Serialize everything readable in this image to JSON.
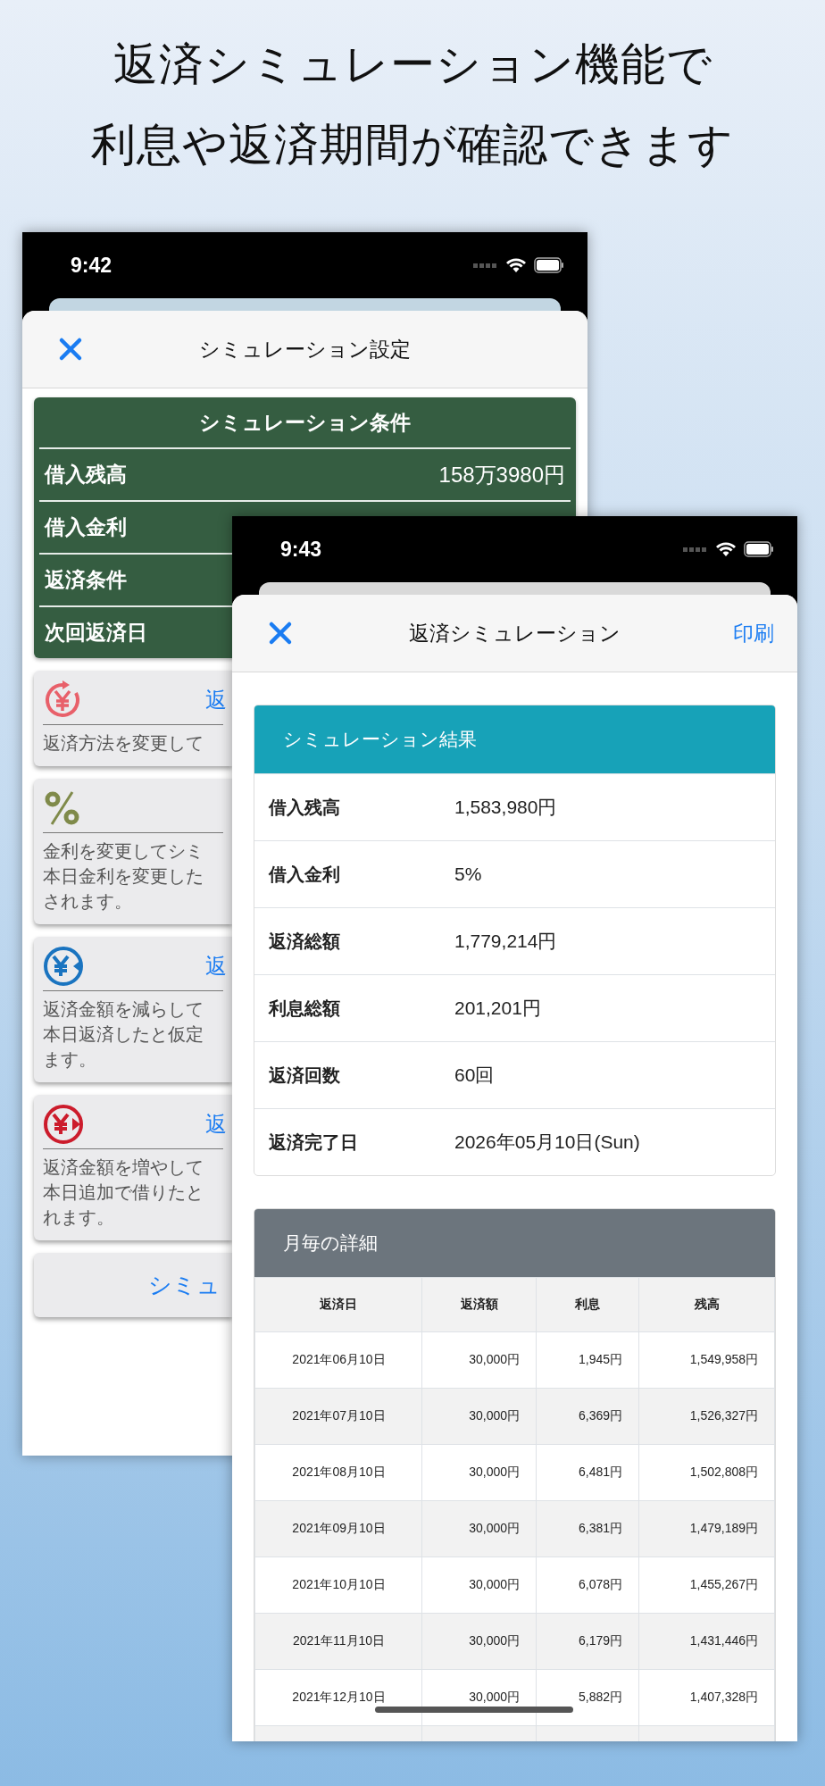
{
  "headline": [
    "返済シミュレーション機能で",
    "利息や返済期間が確認できます"
  ],
  "settings_screen": {
    "status_time": "9:42",
    "title": "シミュレーション設定",
    "conditions": {
      "title": "シミュレーション条件",
      "rows": [
        {
          "label": "借入残高",
          "value": "158万3980円"
        },
        {
          "label": "借入金利"
        },
        {
          "label": "返済条件"
        },
        {
          "label": "次回返済日"
        }
      ]
    },
    "cards": [
      {
        "kind": "cycle",
        "title": "返",
        "description": [
          "返済方法を変更して"
        ]
      },
      {
        "kind": "percent",
        "description": [
          "金利を変更してシミ",
          "本日金利を変更した",
          "されます。"
        ]
      },
      {
        "kind": "reduce",
        "title": "返",
        "description": [
          "返済金額を減らして",
          "本日返済したと仮定",
          "ます。"
        ]
      },
      {
        "kind": "add",
        "title": "返",
        "description": [
          "返済金額を増やして",
          "本日追加で借りたと",
          "れます。"
        ]
      }
    ],
    "button": "シミュ"
  },
  "simulation_screen": {
    "status_time": "9:43",
    "title": "返済シミュレーション",
    "action": "印刷",
    "summary": {
      "title": "シミュレーション結果",
      "rows": [
        {
          "label": "借入残高",
          "value": "1,583,980円"
        },
        {
          "label": "借入金利",
          "value": "5%"
        },
        {
          "label": "返済総額",
          "value": "1,779,214円"
        },
        {
          "label": "利息総額",
          "value": "201,201円"
        },
        {
          "label": "返済回数",
          "value": "60回"
        },
        {
          "label": "返済完了日",
          "value": "2026年05月10日(Sun)"
        }
      ]
    },
    "monthly": {
      "title": "月毎の詳細",
      "columns": [
        "返済日",
        "返済額",
        "利息",
        "残高"
      ],
      "rows": [
        [
          "2021年06月10日",
          "30,000円",
          "1,945円",
          "1,549,958円"
        ],
        [
          "2021年07月10日",
          "30,000円",
          "6,369円",
          "1,526,327円"
        ],
        [
          "2021年08月10日",
          "30,000円",
          "6,481円",
          "1,502,808円"
        ],
        [
          "2021年09月10日",
          "30,000円",
          "6,381円",
          "1,479,189円"
        ],
        [
          "2021年10月10日",
          "30,000円",
          "6,078円",
          "1,455,267円"
        ],
        [
          "2021年11月10日",
          "30,000円",
          "6,179円",
          "1,431,446円"
        ],
        [
          "2021年12月10日",
          "30,000円",
          "5,882円",
          "1,407,328円"
        ]
      ]
    }
  }
}
